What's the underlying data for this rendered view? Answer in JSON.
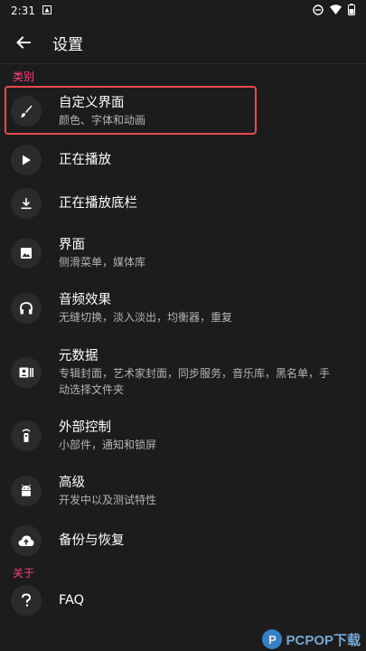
{
  "status_bar": {
    "time": "2:31"
  },
  "app_bar": {
    "title": "设置"
  },
  "sections": {
    "category": "类别",
    "about": "关于"
  },
  "items": {
    "custom_ui": {
      "title": "自定义界面",
      "subtitle": "颜色、字体和动画",
      "icon": "brush-icon"
    },
    "now_playing": {
      "title": "正在播放",
      "icon": "play-icon"
    },
    "now_playing_bar": {
      "title": "正在播放底栏",
      "icon": "download-bar-icon"
    },
    "interface": {
      "title": "界面",
      "subtitle": "侧滑菜单，媒体库",
      "icon": "image-icon"
    },
    "audio": {
      "title": "音频效果",
      "subtitle": "无缝切换，淡入淡出，均衡器，重复",
      "icon": "headphones-icon"
    },
    "metadata": {
      "title": "元数据",
      "subtitle": "专辑封面，艺术家封面，同步服务，音乐库，黑名单，手动选择文件夹",
      "icon": "metadata-icon"
    },
    "external": {
      "title": "外部控制",
      "subtitle": "小部件，通知和锁屏",
      "icon": "remote-icon"
    },
    "advanced": {
      "title": "高级",
      "subtitle": "开发中以及测试特性",
      "icon": "android-icon"
    },
    "backup": {
      "title": "备份与恢复",
      "icon": "cloud-upload-icon"
    },
    "faq": {
      "title": "FAQ",
      "icon": "help-icon"
    }
  },
  "watermark": {
    "text": "PCPOP下载"
  },
  "colors": {
    "accent": "#ff4081",
    "highlight": "#e84a4a",
    "background": "#1c1c1c"
  }
}
